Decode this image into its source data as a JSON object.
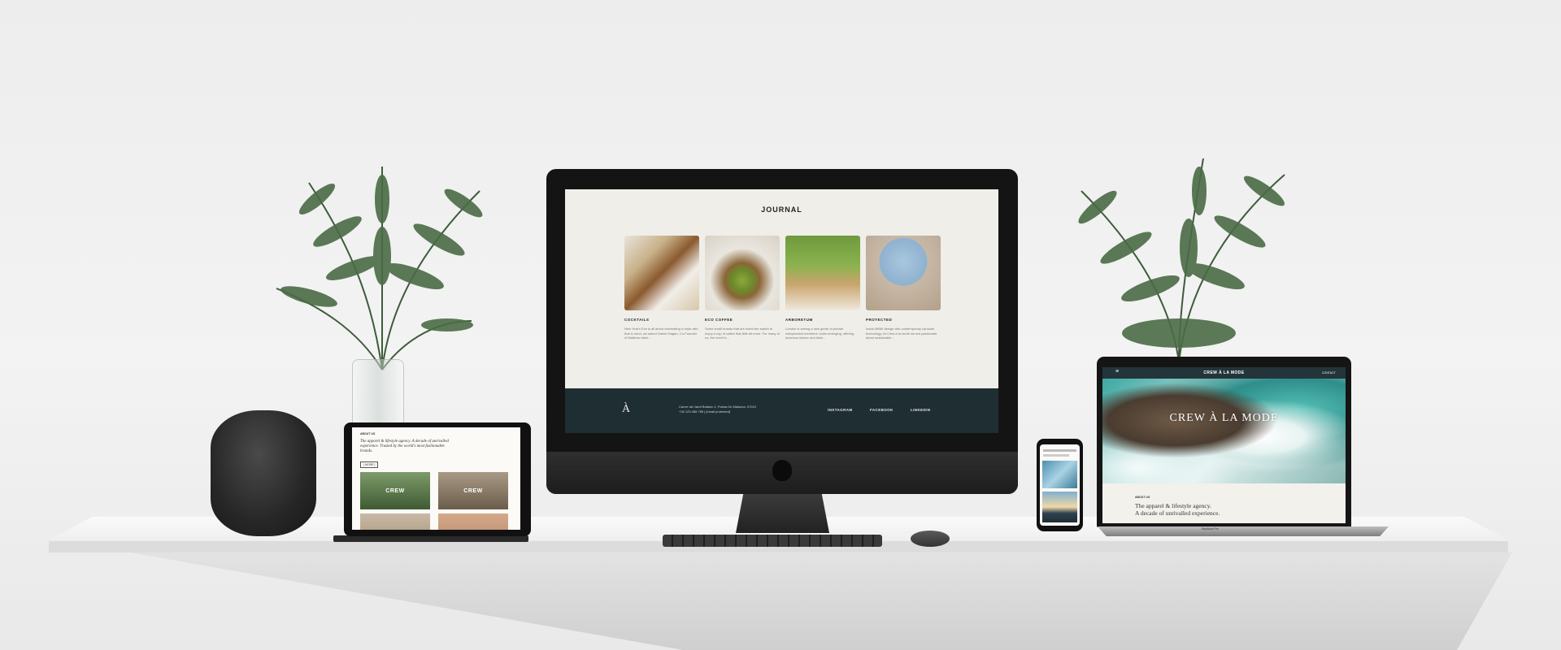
{
  "imac": {
    "journal_title": "JOURNAL",
    "cards": [
      {
        "label": "COCKTAILS",
        "text": "New Year's Eve is all about celebrating in style with that in mind, we asked Daniel Magan, Co-Founder of Matthew drink..."
      },
      {
        "label": "ECO COFFEE",
        "text": "Some small brands that are worth the switch to enjoy a cup of coffee that little bit more. For many of us, the need fo..."
      },
      {
        "label": "ARBORETUM",
        "text": "London is seeing a new genre of private independent members' clubs emerging, offering luxurious leisure and dinin..."
      },
      {
        "label": "PROTECTED",
        "text": "Iconic BMW design with contemporary carousel technology. At Crew à la mode we are passionate about sustainable..."
      }
    ],
    "footer": {
      "logo": "À",
      "address": "Carrer del Jardí Botànic 4, Palma De Mallorca, 07010",
      "phone": "+34 123 456 789 | [email protected]",
      "links": [
        "INSTAGRAM",
        "FACEBOOK",
        "LINKEDIN"
      ]
    }
  },
  "ipad": {
    "heading": "ABOUT US",
    "tagline": "The apparel & lifestyle agency. A decade of unrivalled experience. Trusted by the world's most fashionable brands.",
    "button": "[ MORE ]",
    "tile_texts": [
      "CREW",
      "CREW"
    ]
  },
  "macbook": {
    "nav_left": "≡",
    "nav_title": "CREW À LA MODE",
    "nav_right": "CONTACT",
    "hero_title": "CREW À LA MODE",
    "about_label": "ABOUT US",
    "tagline_1": "The apparel & lifestyle agency.",
    "tagline_2": "A decade of unrivalled experience.",
    "caption": "MacBook Pro"
  },
  "colors": {
    "footer_bg": "#1f2e33",
    "page_bg": "#efeee9",
    "plant_green": "#3d5c3a"
  }
}
